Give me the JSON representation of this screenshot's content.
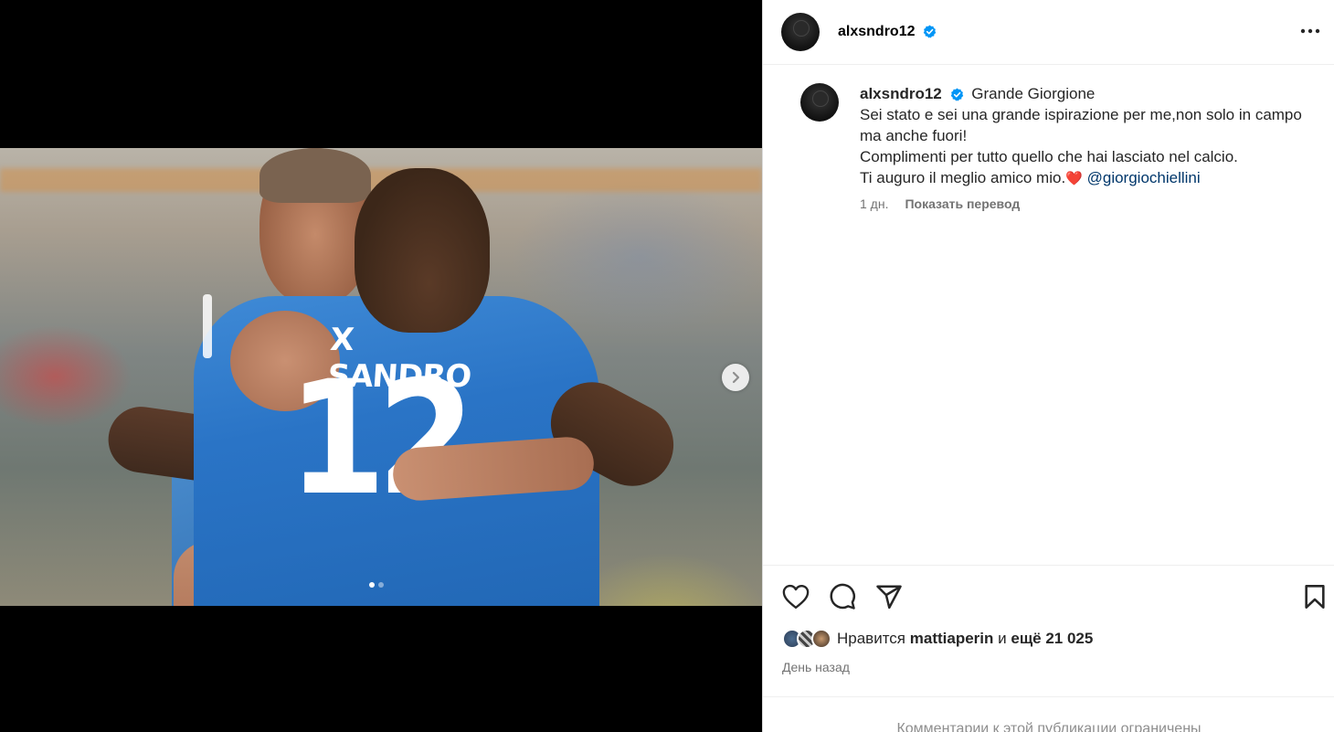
{
  "post": {
    "username": "alxsndro12",
    "verified_icon": "verified-badge-icon",
    "more_icon": "more-options-icon",
    "photo": {
      "shirt_name": "X SANDRO",
      "shirt_number": "12",
      "carousel_total": 2,
      "carousel_current": 1
    },
    "caption": {
      "username": "alxsndro12",
      "line1": "Grande Giorgione",
      "line2": "Sei stato e sei una grande ispirazione per me,non solo in campo ma anche fuori!",
      "line3": "Complimenti per tutto quello che hai lasciato nel calcio.",
      "line4": "Ti auguro il meglio amico mio.",
      "heart": "❤️",
      "mention": "@giorgiochiellini",
      "time": "1 дн.",
      "translate": "Показать перевод"
    },
    "likes": {
      "prefix": "Нравится",
      "user": "mattiaperin",
      "middle": "и",
      "count": "ещё 21 025"
    },
    "date": "День назад",
    "comments_disabled": "Комментарии к этой публикации ограничены"
  },
  "colors": {
    "accent_blue": "#0095f6",
    "mention": "#00376b",
    "muted": "#737373"
  }
}
